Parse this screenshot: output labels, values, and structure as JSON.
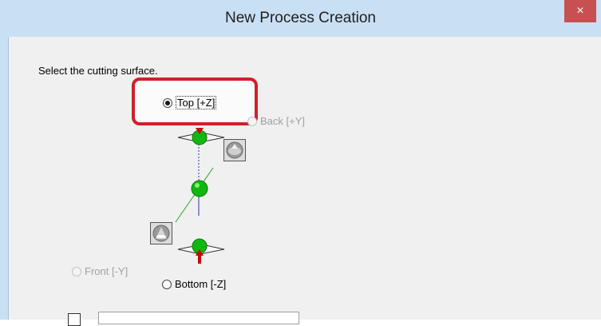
{
  "window": {
    "title": "New Process Creation",
    "close_glyph": "×"
  },
  "dialog": {
    "instruction": "Select the cutting surface.",
    "options": {
      "top": {
        "label": "Top [+Z]",
        "checked": true,
        "enabled": true
      },
      "back": {
        "label": "Back [+Y]",
        "checked": false,
        "enabled": false
      },
      "front": {
        "label": "Front [-Y]",
        "checked": false,
        "enabled": false
      },
      "bottom": {
        "label": "Bottom [-Z]",
        "checked": false,
        "enabled": true
      }
    }
  },
  "colors": {
    "highlight": "#d11f2c",
    "titlebar": "#c9dff3",
    "close": "#c75050"
  }
}
